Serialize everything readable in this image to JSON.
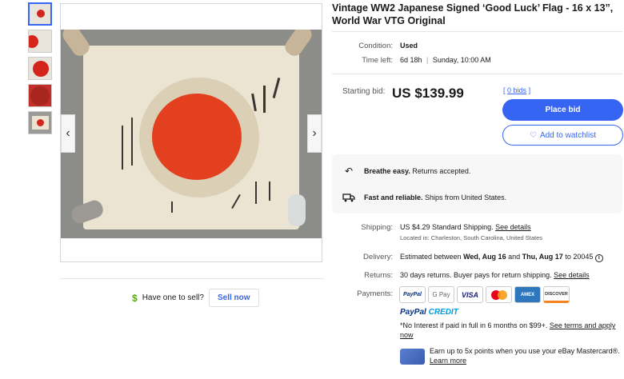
{
  "listing": {
    "title": "Vintage WW2 Japanese Signed ‘Good Luck’ Flag - 16 x 13”, World War VTG Original"
  },
  "details": {
    "condition_label": "Condition:",
    "condition_value": "Used",
    "time_left_label": "Time left:",
    "time_left_value": "6d 18h",
    "time_left_sep": "|",
    "time_left_end": "Sunday, 10:00 AM"
  },
  "bid": {
    "starting_label": "Starting bid:",
    "price": "US $139.99",
    "bids_open": "[",
    "bids_count": "0 bids",
    "bids_close": "]",
    "place_bid_label": "Place bid",
    "watchlist_label": "Add to watchlist"
  },
  "perks": [
    {
      "icon": "return-icon",
      "title": "Breathe easy.",
      "text": "Returns accepted."
    },
    {
      "icon": "truck-icon",
      "title": "Fast and reliable.",
      "text": "Ships from United States."
    }
  ],
  "shipping": {
    "label": "Shipping:",
    "price": "US $4.29",
    "method": "Standard Shipping.",
    "link": "See details",
    "location": "Located in: Charleston, South Carolina, United States"
  },
  "delivery": {
    "label": "Delivery:",
    "prefix": "Estimated between",
    "start": "Wed, Aug 16",
    "and": "and",
    "end": "Thu, Aug 17",
    "to": "to 20045"
  },
  "returns": {
    "label": "Returns:",
    "text": "30 days returns. Buyer pays for return shipping.",
    "link": "See details"
  },
  "payments": {
    "label": "Payments:",
    "cards": [
      "PayPal",
      "G Pay",
      "VISA",
      "Mastercard",
      "AMEX",
      "DISCOVER"
    ],
    "paypal_credit_1": "PayPal",
    "paypal_credit_2": "CREDIT",
    "credit_note": "*No Interest if paid in full in 6 months on $99+.",
    "credit_link": "See terms and apply now",
    "mastercard_note": "Earn up to 5x points when you use your eBay Mastercard®.",
    "mastercard_link": "Learn more"
  },
  "sell": {
    "prompt": "Have one to sell?",
    "button": "Sell now"
  }
}
